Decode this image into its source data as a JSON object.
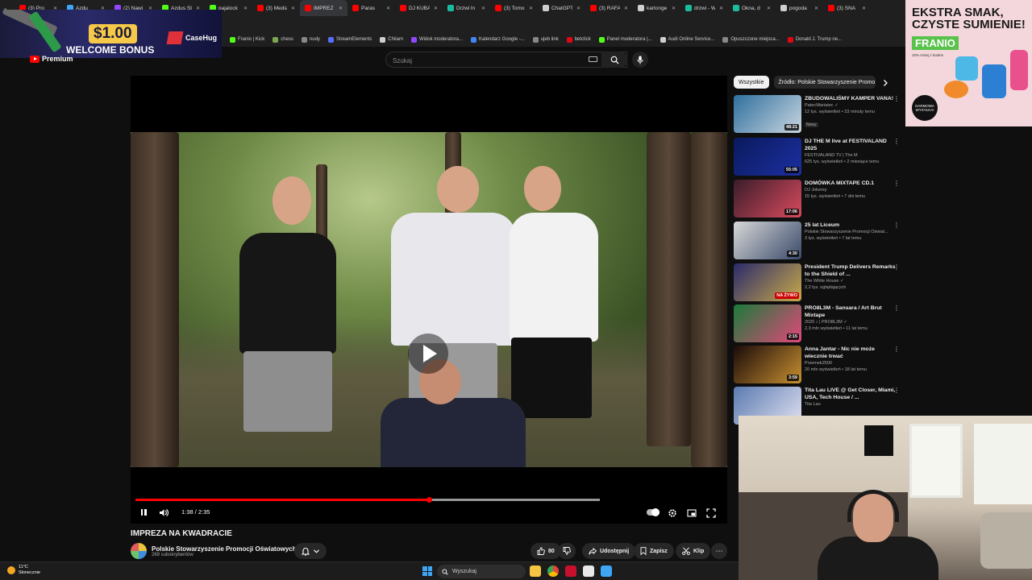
{
  "browser": {
    "tabs": [
      {
        "label": "(3) Pro",
        "color": "#ff0000",
        "active": false
      },
      {
        "label": "Azdu",
        "color": "#3ea6f5",
        "active": false
      },
      {
        "label": "(2) Nawi",
        "color": "#9146ff",
        "active": false
      },
      {
        "label": "Azdus St",
        "color": "#53fc18",
        "active": false
      },
      {
        "label": "pajalock",
        "color": "#53fc18",
        "active": false
      },
      {
        "label": "(3) Media",
        "color": "#ff0000",
        "active": false
      },
      {
        "label": "IMPREZ",
        "color": "#ff0000",
        "active": true
      },
      {
        "label": "Paras",
        "color": "#ff0000",
        "active": false
      },
      {
        "label": "DJ KUBA",
        "color": "#ff0000",
        "active": false
      },
      {
        "label": "Drzwi ln",
        "color": "#1abc9c",
        "active": false
      },
      {
        "label": "(3) Tomo",
        "color": "#ff0000",
        "active": false
      },
      {
        "label": "ChatGPT",
        "color": "#cfcfcf",
        "active": false
      },
      {
        "label": "(3) RAFA",
        "color": "#ff0000",
        "active": false
      },
      {
        "label": "kartonge",
        "color": "#cfcfcf",
        "active": false
      },
      {
        "label": "drzwi - W",
        "color": "#1abc9c",
        "active": false
      },
      {
        "label": "Okna, d",
        "color": "#1abc9c",
        "active": false
      },
      {
        "label": "pogoda",
        "color": "#cfcfcf",
        "active": false
      },
      {
        "label": "(3) SNA",
        "color": "#ff0000",
        "active": false
      }
    ],
    "bookmarks": [
      {
        "label": "Franio | Kick",
        "color": "#53fc18"
      },
      {
        "label": "chess",
        "color": "#7fa650"
      },
      {
        "label": "nudy",
        "color": "#888888"
      },
      {
        "label": "StreamElements",
        "color": "#5b6cff"
      },
      {
        "label": "Chilam",
        "color": "#cfcfcf"
      },
      {
        "label": "Widok moderatora...",
        "color": "#9146ff"
      },
      {
        "label": "Kalendarz Google -...",
        "color": "#4285f4"
      },
      {
        "label": "ujeb link",
        "color": "#888888"
      },
      {
        "label": "betclick",
        "color": "#e30613"
      },
      {
        "label": "Panel moderatora |...",
        "color": "#53fc18"
      },
      {
        "label": "Audi Online Service...",
        "color": "#cfcfcf"
      },
      {
        "label": "Opuszczone miejsca...",
        "color": "#888888"
      },
      {
        "label": "Donald J. Trump ne...",
        "color": "#e30613"
      }
    ]
  },
  "promo": {
    "amount": "$1.00",
    "text": "WELCOME BONUS",
    "brand": "CaseHug"
  },
  "ad": {
    "headline": "EKSTRA SMAK, CZYSTE SUMIENIE!",
    "brand": "FRANIO",
    "fineprint": "10% mniej z kodem",
    "badge": "DARMOWA WYSYŁKA!"
  },
  "youtube": {
    "logo_text": "Premium",
    "search_placeholder": "Szukaj"
  },
  "player": {
    "time_current": "1:38",
    "time_total": "2:35",
    "time_display": "1:38 / 2:35",
    "progress_fraction": 0.632,
    "buffered_fraction": 1.0
  },
  "video": {
    "title": "IMPREZA NA KWADRACIE",
    "channel": "Polskie Stowarzyszenie Promocji Oświatowych",
    "subscribers": "269 subskrybentów",
    "likes": "80",
    "share_label": "Udostępnij",
    "save_label": "Zapisz",
    "clip_label": "Klip"
  },
  "sidebar": {
    "chips": [
      "Wszystkie",
      "Źródło: Polskie Stowarzyszenie Promo"
    ],
    "recommendations": [
      {
        "title": "ZBUDOWALIŚMY KAMPER VANA!",
        "channel": "PatecWariatec",
        "verified": true,
        "views": "12 tys. wyświetleń • 33 minuty temu",
        "badge": "Nowy",
        "duration": "48:21",
        "thumb_colors": [
          "#2f6f9e",
          "#c9d6e0"
        ]
      },
      {
        "title": "DJ THE M live at FESTIVALAND 2025",
        "channel": "FESTIVALAND TV | The M",
        "verified": false,
        "views": "625 tys. wyświetleń • 2 miesiące temu",
        "badge": "",
        "duration": "55:05",
        "thumb_colors": [
          "#0a1a5e",
          "#1c2fa0"
        ]
      },
      {
        "title": "DOMÓWKA MIXTAPE CD.1",
        "channel": "DJ Jokerey",
        "verified": false,
        "views": "15 tys. wyświetleń • 7 dni temu",
        "badge": "",
        "duration": "17:06",
        "thumb_colors": [
          "#3a1d2a",
          "#d94a5e"
        ]
      },
      {
        "title": "25 lat Liceum",
        "channel": "Polskie Stowarzyszenie Promocji Oświat...",
        "verified": false,
        "views": "3 tys. wyświetleń • 7 lat temu",
        "badge": "",
        "duration": "4:30",
        "thumb_colors": [
          "#d8d8d8",
          "#3a4a6a"
        ]
      },
      {
        "title": "President Trump Delivers Remarks to the Shield of ...",
        "channel": "The White House",
        "verified": true,
        "views": "2,2 tys. oglądających",
        "badge": "",
        "duration": "NA ŻYWO",
        "live": true,
        "thumb_colors": [
          "#2a2a6a",
          "#c9a94a"
        ]
      },
      {
        "title": "PRO8L3M - Sansara / Art Brut Mixtape",
        "channel": "2020 ♪ | PRO8L3M",
        "verified": true,
        "views": "2,3 mln wyświetleń • 11 lat temu",
        "badge": "",
        "duration": "2:15",
        "thumb_colors": [
          "#1a7a3a",
          "#e2487a"
        ]
      },
      {
        "title": "Anna Jantar - Nic nie może wiecznie trwać",
        "channel": "Przemek2500",
        "verified": false,
        "views": "20 mln wyświetleń • 18 lat temu",
        "badge": "",
        "duration": "3:59",
        "thumb_colors": [
          "#1a0a0a",
          "#c89030"
        ]
      },
      {
        "title": "Tita Lau LIVE @ Get Closer, Miami, USA, Tech House / ...",
        "channel": "Tita Lau",
        "verified": false,
        "views": "",
        "badge": "",
        "duration": "",
        "thumb_colors": [
          "#5a7ab0",
          "#e0e0f0"
        ]
      }
    ]
  },
  "taskbar": {
    "temp": "11°C",
    "weather": "Słonecznie",
    "search_placeholder": "Wyszukaj"
  }
}
